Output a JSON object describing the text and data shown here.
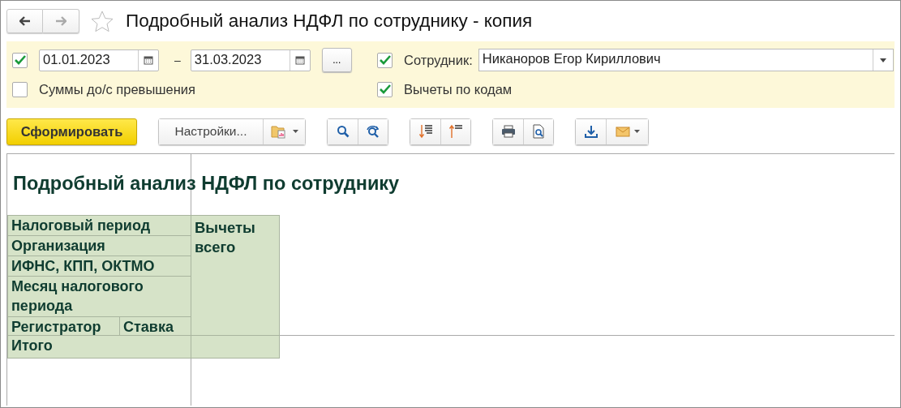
{
  "window": {
    "title": "Подробный анализ НДФЛ по сотруднику - копия",
    "favorite": false
  },
  "filters": {
    "period": {
      "checked": true,
      "from": "01.01.2023",
      "dash": "–",
      "to": "31.03.2023",
      "more_button": "..."
    },
    "amounts_option": {
      "label": "Суммы до/с превышения",
      "checked": false
    },
    "employee": {
      "checked": true,
      "label": "Сотрудник:",
      "value": "Никаноров Егор Кириллович"
    },
    "deductions_option": {
      "label": "Вычеты по кодам",
      "checked": true
    }
  },
  "toolbar": {
    "generate_button": "Сформировать",
    "settings_button": "Настройки..."
  },
  "report": {
    "title": "Подробный анализ НДФЛ по сотруднику",
    "row_headers": [
      "Налоговый период",
      "Организация",
      "ИФНС, КПП, ОКТМО",
      "Месяц налогового периода"
    ],
    "registrar": "Регистратор",
    "rate": "Ставка",
    "column_header": "Вычеты всего",
    "total": "Итого"
  }
}
